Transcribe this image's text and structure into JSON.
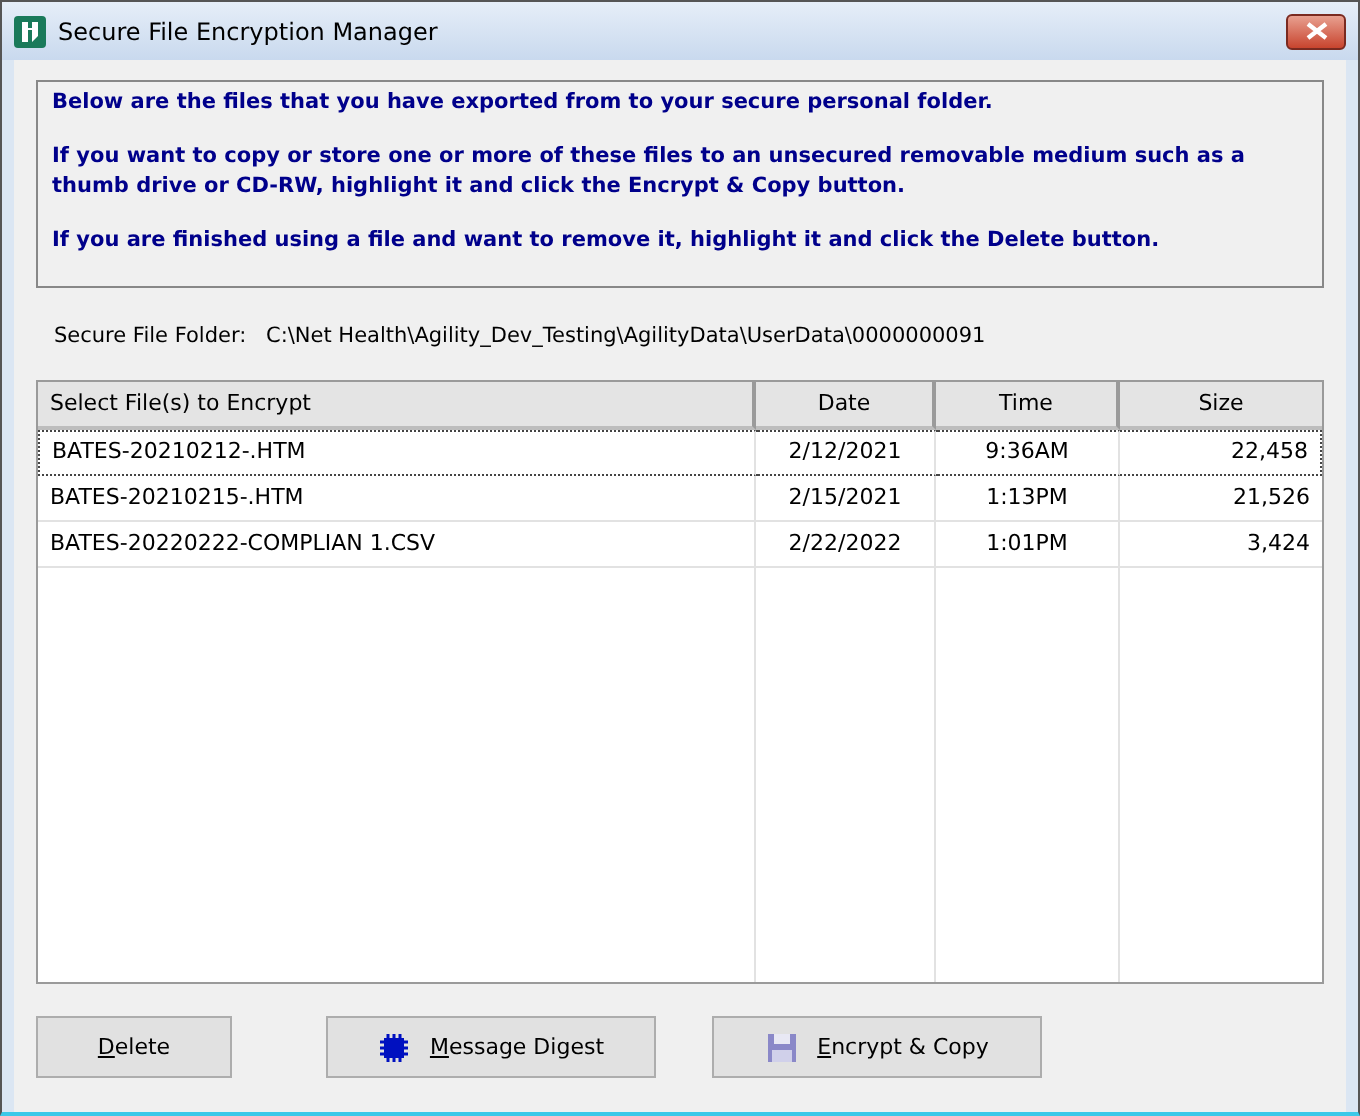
{
  "window": {
    "title": "Secure File Encryption Manager"
  },
  "instructions": [
    "Below are the files that you have exported from to your secure personal folder.",
    "If you want to copy or store one or more of these files to an unsecured removable medium such as a thumb drive or CD-RW, highlight it and click the Encrypt & Copy button.",
    "If you are finished using a file and want to remove it, highlight it and click the Delete button."
  ],
  "folder": {
    "label": "Secure File Folder:",
    "path": "C:\\Net Health\\Agility_Dev_Testing\\AgilityData\\UserData\\0000000091"
  },
  "table": {
    "columns": [
      {
        "label": "Select File(s) to Encrypt"
      },
      {
        "label": "Date"
      },
      {
        "label": "Time"
      },
      {
        "label": "Size"
      }
    ],
    "rows": [
      {
        "cells": [
          "BATES-20210212-.HTM",
          "2/12/2021",
          "9:36AM",
          "22,458"
        ],
        "focused": true
      },
      {
        "cells": [
          "BATES-20210215-.HTM",
          "2/15/2021",
          "1:13PM",
          "21,526"
        ],
        "focused": false
      },
      {
        "cells": [
          "BATES-20220222-COMPLIAN 1.CSV",
          "2/22/2022",
          "1:01PM",
          "3,424"
        ],
        "focused": false
      }
    ]
  },
  "buttons": [
    {
      "kind": "plain",
      "key": "D",
      "rest": "elete"
    },
    {
      "kind": "digest",
      "key": "M",
      "rest": "essage Digest"
    },
    {
      "kind": "floppy",
      "key": "E",
      "rest": "ncrypt & Copy"
    }
  ]
}
